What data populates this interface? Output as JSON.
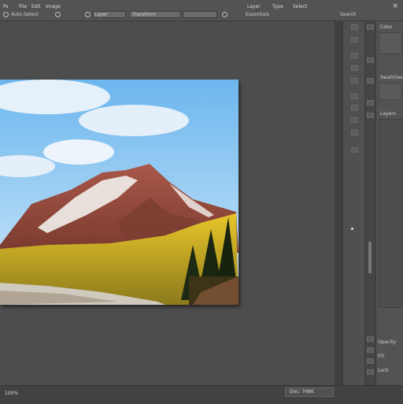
{
  "menu": {
    "items": [
      "Ps",
      "File",
      "Edit",
      "Image",
      "Layer",
      "Type",
      "Select"
    ],
    "close_icon": "×"
  },
  "options": {
    "items": [
      "Auto-Select",
      "Layer",
      "Transform"
    ],
    "right_items": [
      "Essentials",
      "Search"
    ]
  },
  "right_panel": {
    "tabs": [
      "Color",
      "Swatches",
      "Layers"
    ],
    "labels": [
      "Opacity",
      "Fill",
      "Lock"
    ]
  },
  "status": {
    "zoom": "100%",
    "doc_info": "Doc: 768K"
  },
  "colors": {
    "accent": "#31a8ff",
    "chrome": "#535353",
    "canvas_bg": "#4b4b4b"
  }
}
